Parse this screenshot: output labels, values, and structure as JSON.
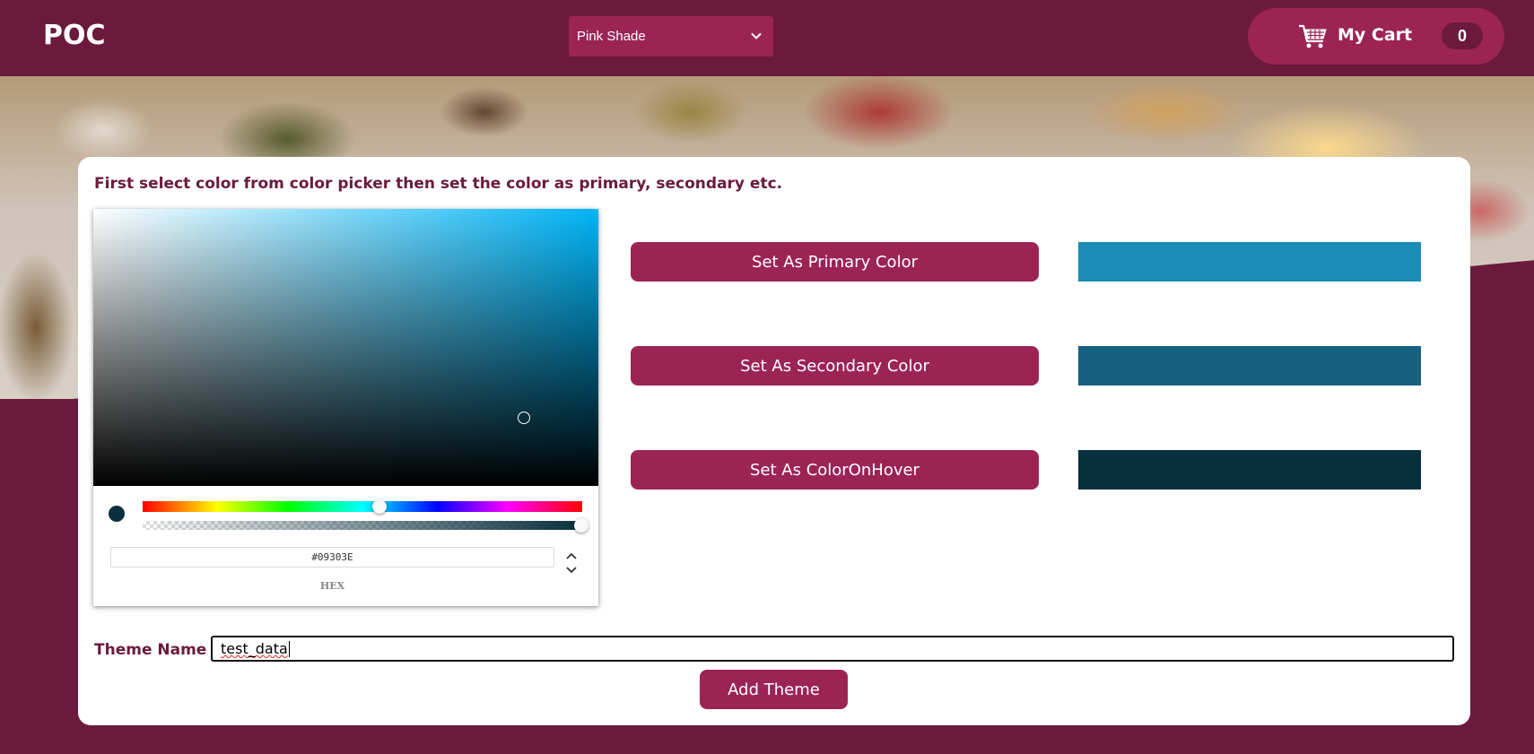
{
  "header": {
    "logo": "POC",
    "theme_select": {
      "selected": "Pink Shade"
    },
    "cart": {
      "label": "My Cart",
      "count": "0"
    }
  },
  "colors": {
    "primary_bg": "#6b1a3d",
    "accent": "#9b2455",
    "primary_preview": "#1b8bb8",
    "secondary_preview": "#176180",
    "hover_preview": "#09303e"
  },
  "main": {
    "instruction": "First select color from color picker then set the color as primary, secondary etc.",
    "picker": {
      "hex_value": "#09303E",
      "hex_label": "HEX"
    },
    "buttons": {
      "primary": "Set As Primary Color",
      "secondary": "Set As Secondary Color",
      "hover": "Set As ColorOnHover"
    },
    "theme_name_label": "Theme Name",
    "theme_name_value": "test_data",
    "add_theme": "Add Theme"
  }
}
